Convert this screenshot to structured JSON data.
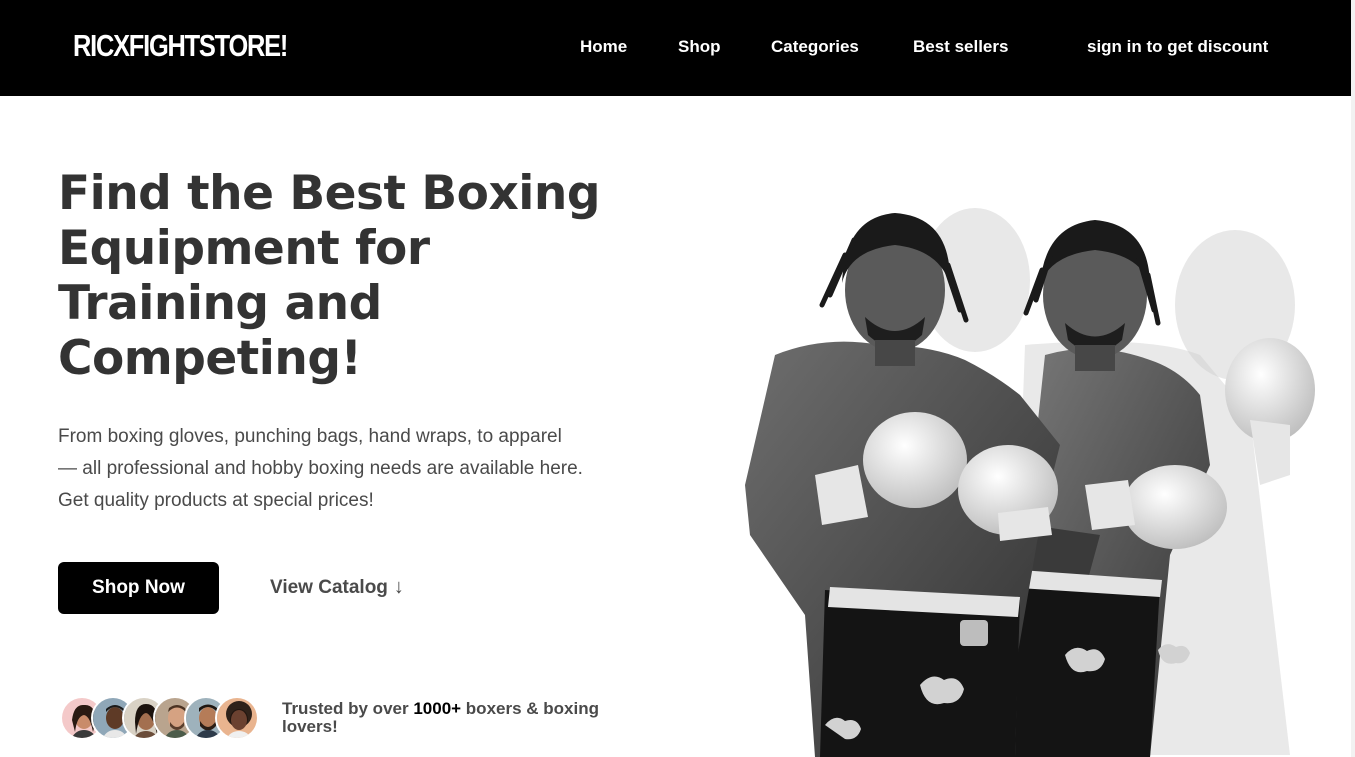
{
  "brand": {
    "logo": "RICXFIGHTSTORE!"
  },
  "nav": {
    "home": "Home",
    "shop": "Shop",
    "categories": "Categories",
    "best_sellers": "Best sellers",
    "signin": "sign in to get discount"
  },
  "hero": {
    "title_lines": [
      "Find the Best Boxing",
      "Equipment for",
      "Training and",
      "Competing!"
    ],
    "description_lines": [
      "From boxing gloves, punching bags, hand wraps, to apparel",
      "— all professional and hobby boxing needs are available here.",
      "Get quality products at special prices!"
    ],
    "shop_button": "Shop Now",
    "catalog_link": "View Catalog",
    "catalog_arrow": "↓"
  },
  "social_proof": {
    "prefix": "Trusted by over ",
    "count": "1000+",
    "suffix": " boxers & boxing lovers!",
    "avatar_count": 6
  },
  "colors": {
    "navbar": "#000000",
    "text": "#333333",
    "button": "#000000"
  }
}
